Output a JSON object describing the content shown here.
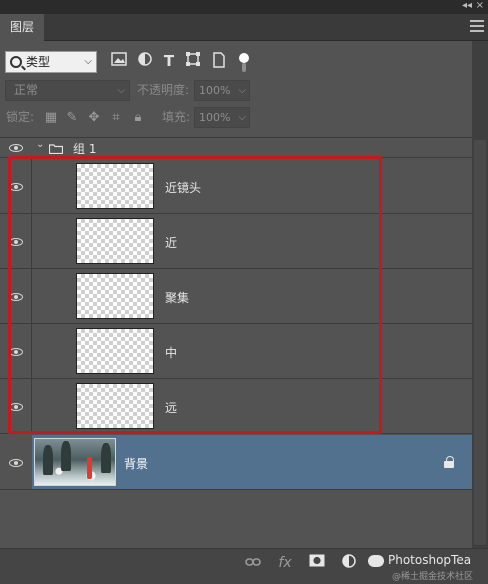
{
  "panel": {
    "tab_label": "图层",
    "collapse_glyph": "◂◂",
    "close_glyph": "×",
    "menu_icon": "hamburger-icon"
  },
  "filter": {
    "kind_label": "类型",
    "icons": [
      "image-filter-icon",
      "adjustment-filter-icon",
      "type-filter-icon",
      "shape-filter-icon",
      "smart-object-filter-icon",
      "filter-toggle"
    ]
  },
  "blend": {
    "mode": "正常",
    "opacity_label": "不透明度:",
    "opacity_value": "100%"
  },
  "lock": {
    "label": "锁定:",
    "icons": [
      "lock-transparent-icon",
      "lock-paint-icon",
      "lock-position-icon",
      "lock-artboard-icon",
      "lock-all-icon"
    ],
    "fill_label": "填充:",
    "fill_value": "100%"
  },
  "group": {
    "name": "组 1"
  },
  "layers": [
    {
      "name": "近镜头"
    },
    {
      "name": "近"
    },
    {
      "name": "聚集"
    },
    {
      "name": "中"
    },
    {
      "name": "远"
    }
  ],
  "background_layer": {
    "name": "背景",
    "locked": true
  },
  "highlight_color": "#c8181f",
  "selected_color": "#52718f",
  "footer": {
    "icons": [
      "link-layers-icon",
      "fx-icon",
      "mask-icon",
      "adjustment-icon"
    ],
    "fx_label": "fx",
    "watermark": "PhotoshopTea",
    "watermark_sub": "@稀土掘金技术社区"
  }
}
